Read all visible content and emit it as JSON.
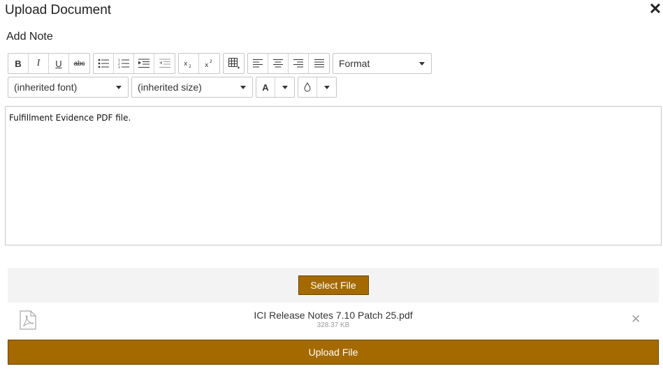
{
  "dialog": {
    "title": "Upload Document",
    "close_icon": "close-icon"
  },
  "note": {
    "label": "Add Note"
  },
  "toolbar": {
    "format_label": "Format",
    "font_label": "(inherited font)",
    "size_label": "(inherited size)",
    "font_color_glyph": "A",
    "buttons": {
      "bold": "B",
      "italic": "I",
      "underline": "U",
      "strike": "abc"
    },
    "icons": [
      "bold-icon",
      "italic-icon",
      "underline-icon",
      "strikethrough-icon",
      "bullet-list-icon",
      "numbered-list-icon",
      "indent-icon",
      "outdent-icon",
      "subscript-icon",
      "superscript-icon",
      "table-icon",
      "align-left-icon",
      "align-center-icon",
      "align-right-icon",
      "justify-icon",
      "font-color-icon",
      "background-color-icon"
    ]
  },
  "editor": {
    "content": "Fulfillment Evidence PDF file."
  },
  "upload": {
    "select_label": "Select File",
    "file_name": "ICI Release Notes 7.10 Patch 25.pdf",
    "file_size": "328.37 KB",
    "remove_glyph": "✕",
    "upload_label": "Upload File"
  },
  "colors": {
    "accent": "#a46a00",
    "accent_border": "#6b4500",
    "panel_bg": "#f3f3f3",
    "border": "#c6c6c6"
  }
}
